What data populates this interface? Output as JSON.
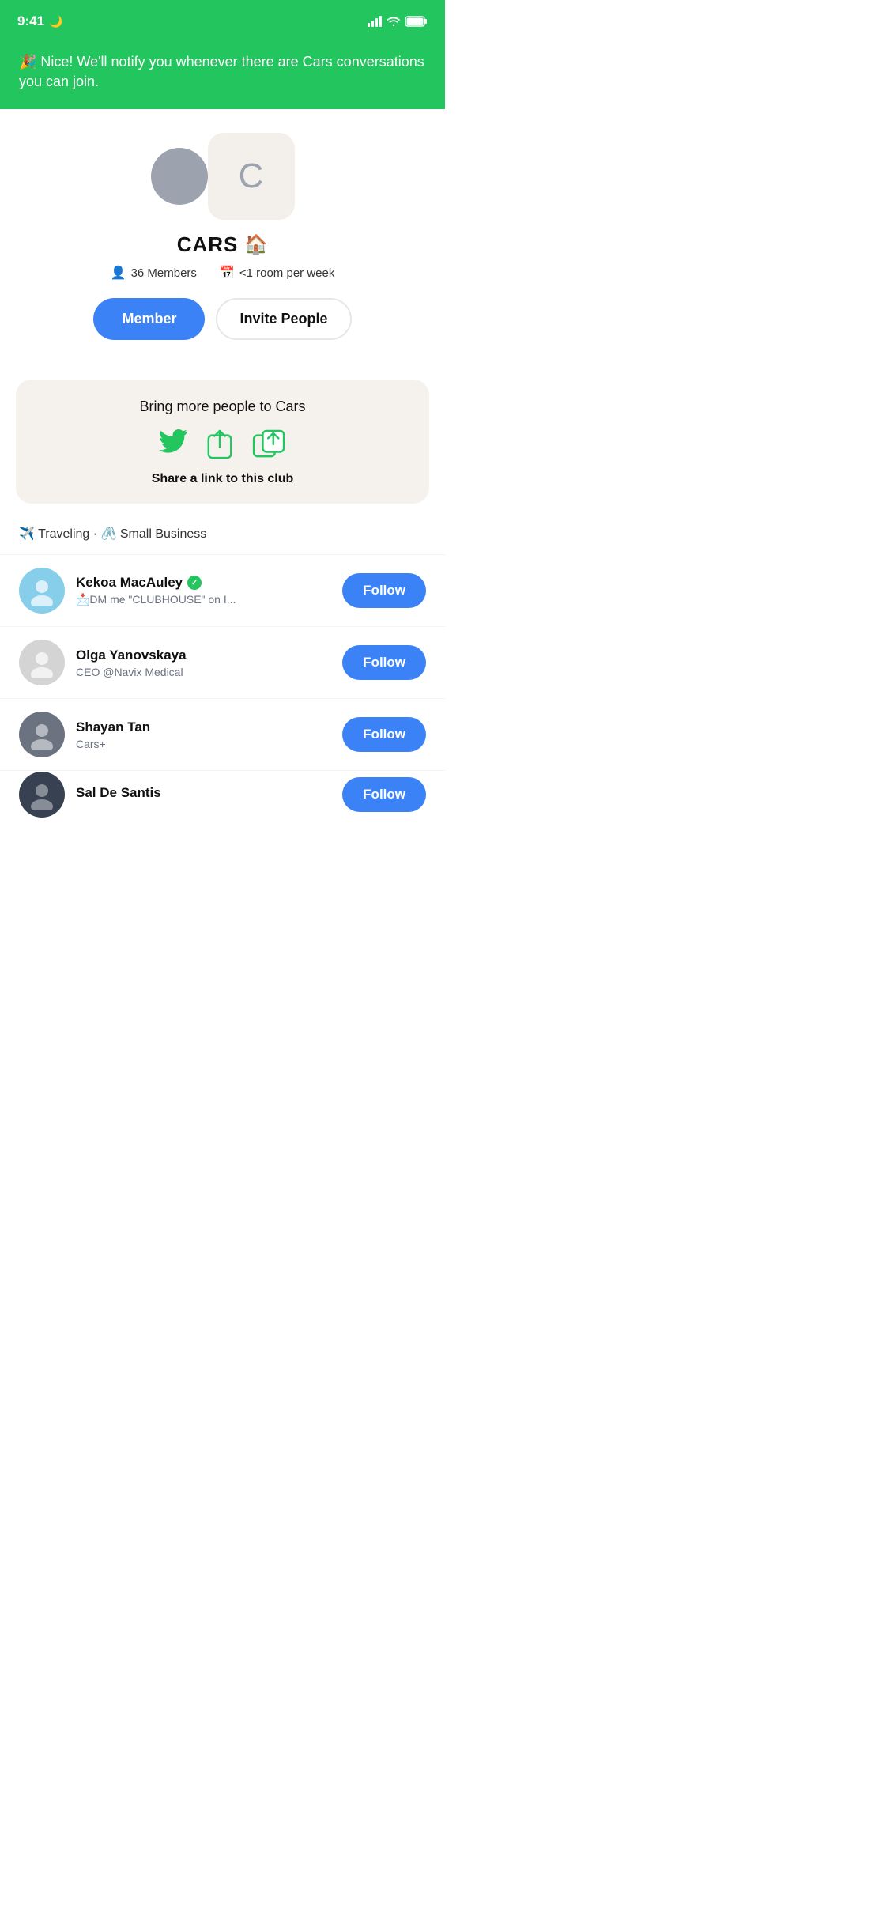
{
  "statusBar": {
    "time": "9:41",
    "moonIcon": "🌙"
  },
  "notification": {
    "emoji": "🎉",
    "text": "Nice! We'll notify you whenever there are Cars conversations you can join."
  },
  "club": {
    "name": "CARS",
    "houseEmoji": "🏠",
    "members": "36 Members",
    "frequency": "<1 room per week",
    "avatarLetter": "C",
    "memberButtonLabel": "Member",
    "inviteButtonLabel": "Invite People"
  },
  "shareCard": {
    "title": "Bring more people to Cars",
    "linkLabel": "Share a link to this club"
  },
  "tags": "✈️ Traveling · 🖇️ Small Business",
  "membersList": [
    {
      "name": "Kekoa MacAuley",
      "verified": true,
      "bio": "📩DM me \"CLUBHOUSE\" on I...",
      "followLabel": "Follow"
    },
    {
      "name": "Olga Yanovskaya",
      "verified": false,
      "bio": "CEO @Navix Medical",
      "followLabel": "Follow"
    },
    {
      "name": "Shayan Tan",
      "verified": false,
      "bio": "Cars+",
      "followLabel": "Follow"
    },
    {
      "name": "Sal De Santis",
      "verified": false,
      "bio": "",
      "followLabel": "Follow",
      "partial": true
    }
  ],
  "avatarColors": [
    "#87CEEB",
    "#D4D4D4",
    "#6B7280",
    "#374151"
  ]
}
